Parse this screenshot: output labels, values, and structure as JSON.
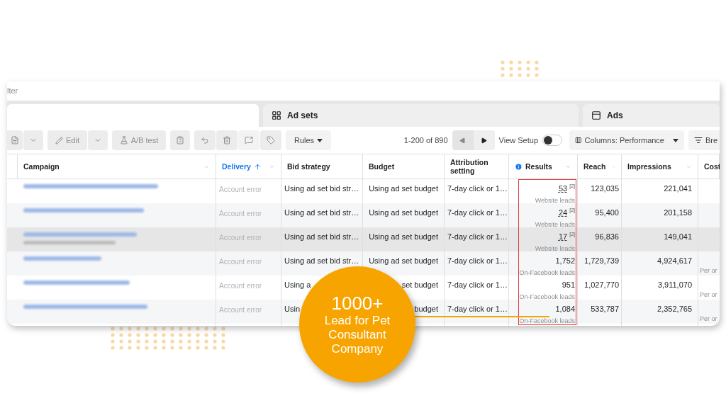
{
  "filter": {
    "text": "lter"
  },
  "tabs": [
    {
      "kind": "campaigns",
      "selected": true
    },
    {
      "kind": "adsets",
      "label": "Ad sets",
      "selected": false
    },
    {
      "kind": "ads",
      "label": "Ads",
      "selected": false
    }
  ],
  "toolbar": {
    "edit": "Edit",
    "ab_test": "A/B test",
    "rules": "Rules",
    "pagination": "1-200 of 890",
    "view_setup": {
      "label": "View Setup",
      "on": false
    },
    "columns": "Columns: Performance",
    "breakdown": "Bre"
  },
  "columns": [
    {
      "label": "Campaign",
      "menu": true,
      "sorted": false
    },
    {
      "label": "Delivery",
      "menu": true,
      "sorted": true
    },
    {
      "label": "Bid strategy",
      "menu": false,
      "sorted": false
    },
    {
      "label": "Budget",
      "menu": false,
      "sorted": false
    },
    {
      "label": "Attribution setting",
      "menu": false,
      "sorted": false
    },
    {
      "label": "Results",
      "menu": true,
      "sorted": false,
      "info": true
    },
    {
      "label": "Reach",
      "menu": true,
      "sorted": false
    },
    {
      "label": "Impressions",
      "menu": true,
      "sorted": false
    },
    {
      "label": "Cost",
      "sorted": false
    }
  ],
  "rows": [
    {
      "highlighted": false,
      "tags": false,
      "delivery": "Account error",
      "bid_strategy": "Using ad set bid str…",
      "budget": "Using ad set budget",
      "attribution": "7-day click or 1…",
      "result": "53",
      "result_note": "[2]",
      "result_type": "Website leads",
      "reach": "123,035",
      "impressions": "221,041"
    },
    {
      "highlighted": false,
      "tags": false,
      "delivery": "Account error",
      "bid_strategy": "Using ad set bid str…",
      "budget": "Using ad set budget",
      "attribution": "7-day click or 1…",
      "result": "24",
      "result_note": "[2]",
      "result_type": "Website leads",
      "reach": "95,400",
      "impressions": "201,158"
    },
    {
      "highlighted": true,
      "tags": true,
      "delivery": "Account error",
      "bid_strategy": "Using ad set bid str…",
      "budget": "Using ad set budget",
      "attribution": "7-day click or 1…",
      "result": "17",
      "result_note": "[2]",
      "result_type": "Website leads",
      "reach": "96,836",
      "impressions": "149,041"
    },
    {
      "highlighted": false,
      "tags": false,
      "delivery": "Account error",
      "bid_strategy": "Using ad set bid str…",
      "budget": "Using ad set budget",
      "attribution": "7-day click or 1…",
      "result": "1,752",
      "result_type": "On-Facebook leads",
      "reach": "1,729,739",
      "impressions": "4,924,617",
      "cost": "Per or"
    },
    {
      "highlighted": false,
      "tags": false,
      "delivery": "Account error",
      "bid_strategy": "Using a",
      "budget": "set budget",
      "attribution": "7-day click or 1…",
      "result": "951",
      "result_type": "On-Facebook leads",
      "reach": "1,027,770",
      "impressions": "3,911,070",
      "cost": "Per or"
    },
    {
      "highlighted": false,
      "tags": false,
      "delivery": "Account error",
      "bid_strategy": "Usin",
      "budget": "budget",
      "attribution": "7-day click or 1…",
      "result": "1,084",
      "result_type": "On-Facebook leads",
      "reach": "533,787",
      "impressions": "2,352,765",
      "cost": "Per or"
    }
  ],
  "callout": {
    "headline": "1000+",
    "text": "Lead for Pet Consultant Company"
  }
}
